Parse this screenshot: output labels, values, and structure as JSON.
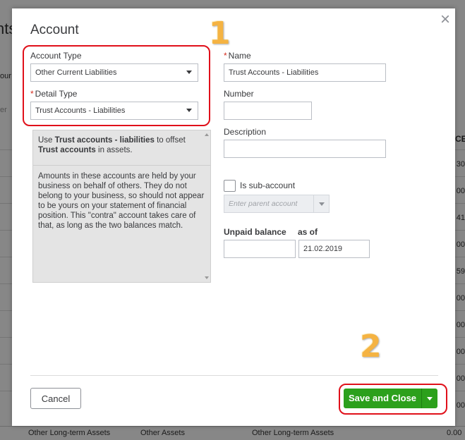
{
  "background": {
    "title_fragment": "nts",
    "label_fragment": "our c",
    "filter_fragment": "er",
    "column_header_fragment": "CE",
    "row_values": [
      "30",
      "00",
      "41",
      "00",
      "59",
      "00",
      "00",
      "00",
      "00",
      "00"
    ],
    "bottom_row": {
      "col1": "Other Long-term Assets",
      "col2": "Other Assets",
      "col3": "Other Long-term Assets",
      "col4": "0.00"
    }
  },
  "modal": {
    "title": "Account",
    "close_label": "×",
    "account_type": {
      "label": "Account Type",
      "value": "Other Current Liabilities"
    },
    "detail_type": {
      "label": "Detail Type",
      "required_mark": "*",
      "value": "Trust Accounts - Liabilities"
    },
    "description_help": {
      "p1_pre": "Use ",
      "p1_bold1": "Trust accounts - liabilities",
      "p1_mid": " to offset ",
      "p1_bold2": "Trust accounts",
      "p1_post": " in assets.",
      "p2": "Amounts in these accounts are held by your business on behalf of others. They do not belong to your business, so should not appear to be yours on your statement of financial position. This \"contra\" account takes care of that, as long as the two balances match."
    },
    "name": {
      "label": "Name",
      "required_mark": "*",
      "value": "Trust Accounts - Liabilities"
    },
    "number": {
      "label": "Number",
      "value": ""
    },
    "description": {
      "label": "Description",
      "value": ""
    },
    "sub_account": {
      "label": "Is sub-account",
      "checked": false
    },
    "parent_account": {
      "placeholder": "Enter parent account"
    },
    "unpaid_balance": {
      "label": "Unpaid balance",
      "value": ""
    },
    "as_of": {
      "label": "as of",
      "value": "21.02.2019"
    },
    "cancel_label": "Cancel",
    "save_label": "Save and Close"
  },
  "annotations": {
    "step1": "1",
    "step2": "2"
  },
  "colors": {
    "primary_green": "#2ca01c",
    "highlight_red": "#e0101a",
    "annotation_orange": "#f5b342",
    "required_red": "#d52b1e"
  }
}
